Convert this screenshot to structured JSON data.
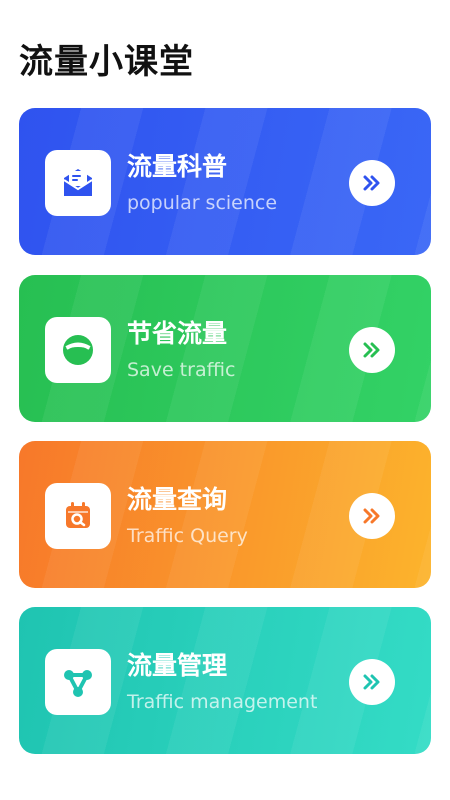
{
  "header": {
    "title": "流量小课堂"
  },
  "cards": [
    {
      "title": "流量科普",
      "subtitle": "popular science",
      "icon": "envelope-icon",
      "accent": "#2f53ef"
    },
    {
      "title": "节省流量",
      "subtitle": "Save traffic",
      "icon": "circle-save-icon",
      "accent": "#27bf52"
    },
    {
      "title": "流量查询",
      "subtitle": "Traffic Query",
      "icon": "calendar-search-icon",
      "accent": "#f7782a"
    },
    {
      "title": "流量管理",
      "subtitle": "Traffic management",
      "icon": "network-nodes-icon",
      "accent": "#1fc4b1"
    }
  ]
}
